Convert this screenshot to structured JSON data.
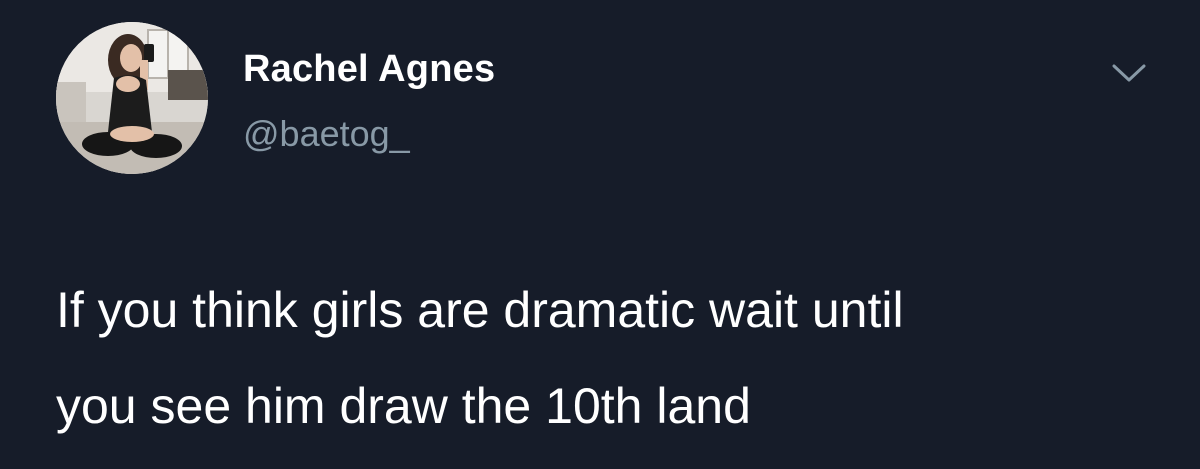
{
  "tweet": {
    "display_name": "Rachel Agnes",
    "handle": "@baetog_",
    "text_lines": [
      "If you think girls are dramatic wait until",
      "you see him draw the 10th land"
    ]
  },
  "icons": {
    "menu": "chevron-down-icon",
    "avatar": "avatar"
  },
  "colors": {
    "background": "#161c29",
    "primary_text": "#ffffff",
    "secondary_text": "#8899a6"
  }
}
